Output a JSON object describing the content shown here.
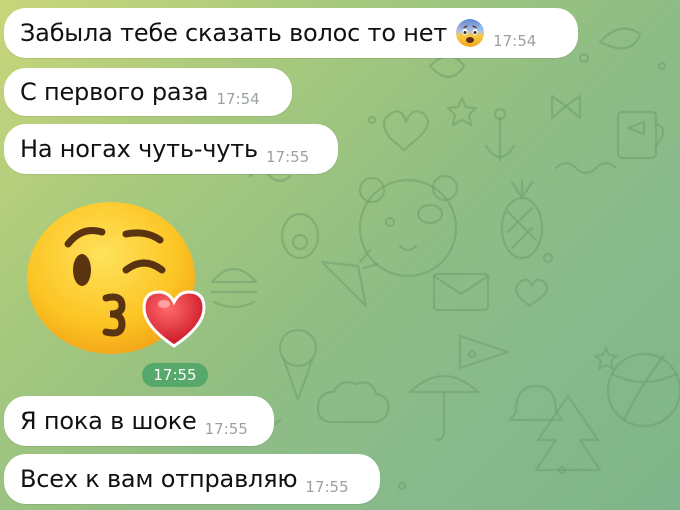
{
  "chat": {
    "messages": [
      {
        "text": "Забыла тебе сказать волос то нет",
        "emoji": "anxious-face-with-sweat-icon",
        "time": "17:54"
      },
      {
        "text": "С первого раза",
        "time": "17:54"
      },
      {
        "text": "На ногах чуть-чуть",
        "time": "17:55"
      },
      {
        "sticker": "face-blowing-kiss-icon",
        "time": "17:55"
      },
      {
        "text": "Я пока в шоке",
        "time": "17:55"
      },
      {
        "text": "Всех к вам отправляю",
        "time": "17:55"
      }
    ]
  },
  "colors": {
    "bubble": "#ffffff",
    "time_gray": "#9aa1a6",
    "sticker_time_badge": "#56a96a",
    "wallpaper_top": "#c9d67a",
    "wallpaper_bottom": "#7fb48a"
  }
}
